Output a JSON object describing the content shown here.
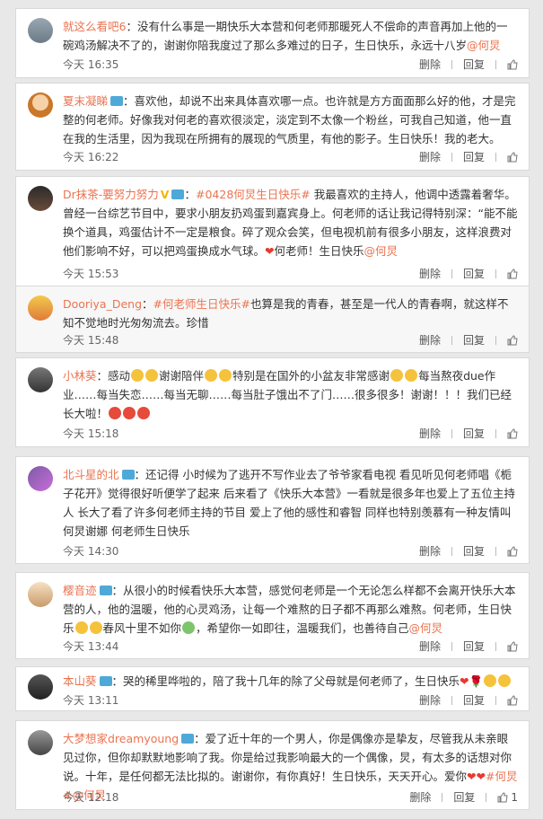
{
  "actions": {
    "delete": "删除",
    "reply": "回复"
  },
  "comments": [
    {
      "user": "就这么看吧6",
      "pre": "：没有什么事是一期快乐大本营和何老师那暖死人不偿命的声音再加上他的一碗鸡汤解决不了的，谢谢你陪我度过了那么多难过的日子，生日快乐，永远十八岁",
      "mention": "@何炅",
      "time": "今天 16:35"
    },
    {
      "user": "夏末凝睇",
      "pre": "：喜欢他，却说不出来具体喜欢哪一点。也许就是方方面面那么好的他，才是完整的何老师。好像我对何老的喜欢很淡定，淡定到不太像一个粉丝，可我自己知道，他一直在我的生活里，因为我现在所拥有的展现的气质里，有他的影子。生日快乐！我的老大。",
      "time": "今天 16:22"
    },
    {
      "user": "Dr抹茶-要努力努力",
      "tag": "#0428何炅生日快乐#",
      "pre": " 我最喜欢的主持人，他调中透露着奢华。曾经一台综艺节目中，要求小朋友扔鸡蛋到嘉宾身上。何老师的话让我记得特别深：“能不能换个道具，鸡蛋估计不一定是粮食。碎了观众会笑，但电视机前有很多小朋友，这样浪费对他们影响不好，可以把鸡蛋换成水气球。",
      "post": "何老师！生日快乐",
      "mention": "@何炅",
      "time": "今天 15:53"
    },
    {
      "user": "Dooriya_Deng",
      "tag": "#何老师生日快乐#",
      "pre": "也算是我的青春，甚至是一代人的青春啊，就这样不知不觉地时光匆匆流去。珍惜",
      "time": "今天 15:48"
    },
    {
      "user": "小林葵",
      "pre": "：感动",
      "mid": "谢谢陪伴",
      "mid2": "特别是在国外的小盆友非常感谢",
      "post": "每当熬夜due作业……每当失恋……每当无聊……每当肚子饿出不了门……很多很多！谢谢！！！我们已经长大啦！",
      "time": "今天 15:18"
    },
    {
      "user": "北斗星的北",
      "pre": "：还记得 小时候为了逃开不写作业去了爷爷家看电视 看见听见何老师唱《栀子花开》觉得很好听便学了起来 后来看了《快乐大本营》一看就是很多年也爱上了五位主持人 长大了看了许多何老师主持的节目 爱上了他的感性和睿智 同样也特别羡慕有一种友情叫何炅谢娜 何老师生日快乐",
      "time": "今天 14:30"
    },
    {
      "user": "樱音迹",
      "pre": "：从很小的时候看快乐大本营，感觉何老师是一个无论怎么样都不会离开快乐大本营的人，他的温暖，他的心灵鸡汤，让每一个难熬的日子都不再那么难熬。何老师，生日快乐",
      "post": "春风十里不如你",
      "post2": "，希望你一如即往，温暖我们，也善待自己",
      "mention": "@何炅",
      "time": "今天 13:44"
    },
    {
      "user": "本山葵",
      "pre": "：哭的稀里哗啦的，陪了我十几年的除了父母就是何老师了，生日快乐",
      "time": "今天 13:11"
    },
    {
      "user": "大梦想家dreamyoung",
      "pre": "：爱了近十年的一个男人，你是偶像亦是挚友，尽管我从未亲眼见过你，但你却默默地影响了我。你是给过我影响最大的一个偶像，炅，有太多的话想对你说。十年，是任何都无法比拟的。谢谢你，有你真好！生日快乐，天天开心。爱你",
      "tag": "#何炅#",
      "mention": "@何炅",
      "time": "今天 12:18",
      "like": "1"
    }
  ],
  "colors": {
    "accent": "#eb7350",
    "background": "#e8e8e8",
    "text": "#333333"
  }
}
